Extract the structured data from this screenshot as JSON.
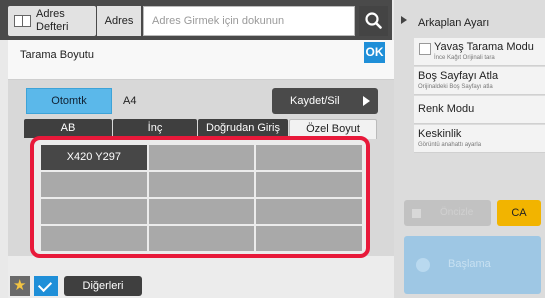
{
  "topbar": {
    "address_book_label": "Adres\nDefteri",
    "address_tab_label": "Adres",
    "address_input_placeholder": "Adres Girmek için dokunun"
  },
  "panel": {
    "title": "Tarama Boyutu",
    "ok_label": "OK",
    "auto_button_label": "Otomtk",
    "current_size": "A4",
    "store_delete_label": "Kaydet/Sil",
    "tabs": [
      {
        "label": "AB",
        "active": false
      },
      {
        "label": "İnç",
        "active": false
      },
      {
        "label": "Doğrudan Giriş",
        "active": false
      },
      {
        "label": "Özel Boyut",
        "active": true
      }
    ],
    "custom_sizes": [
      "X420 Y297",
      "",
      "",
      "",
      "",
      "",
      "",
      "",
      "",
      "",
      "",
      ""
    ]
  },
  "bottom": {
    "others_label": "Diğerleri"
  },
  "right_panel": {
    "header": "Arkaplan Ayarı",
    "items": [
      {
        "label": "Yavaş Tarama Modu",
        "sub": "İnce Kağıt Orijinali tara",
        "checkbox": true
      },
      {
        "label": "Boş Sayfayı Atla",
        "sub": "Orijinaldeki Boş Sayfayı atla",
        "checkbox": false
      },
      {
        "label": "Renk Modu",
        "sub": "",
        "checkbox": false
      },
      {
        "label": "Keskinlik",
        "sub": "Görüntü anahattı ayarla",
        "checkbox": false
      }
    ],
    "ca_label": "CA",
    "offset_label": "Öncizle",
    "start_label": "Başlama"
  },
  "colors": {
    "accent_blue": "#1f8fd8",
    "highlight_red": "#e8193a",
    "ca_yellow": "#f2b400"
  }
}
